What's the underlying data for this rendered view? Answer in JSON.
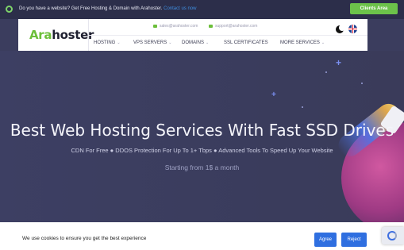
{
  "topbar": {
    "message": "Do you have a website? Get Free Hosting & Domain with Arahoster.",
    "contact_link": "Contact us now",
    "clients_button": "Clients Area"
  },
  "header": {
    "logo_part1": "Ara",
    "logo_part2": "hoster",
    "sales_email": "sales@arahoster.com",
    "support_email": "support@arahoster.com",
    "nav": [
      {
        "label": "HOSTING",
        "dropdown": true
      },
      {
        "label": "VPS SERVERS",
        "dropdown": true
      },
      {
        "label": "DOMAINS",
        "dropdown": true
      },
      {
        "label": "SSL CERTIFICATES",
        "dropdown": false
      },
      {
        "label": "MORE SERVICES",
        "dropdown": true
      }
    ],
    "icons": [
      "dark-mode-icon",
      "uk-flag-icon"
    ]
  },
  "hero": {
    "title": "Best Web Hosting Services With Fast SSD Drives",
    "subtitle": "CDN For Free ● DDOS Protection For Up To 1+ Tbps ● Advanced Tools To Speed Up Your Website",
    "price": "Starting from 1$ a month"
  },
  "cookie": {
    "text": "We use cookies to ensure you get the best experience",
    "agree": "Agree",
    "reject": "Reject"
  },
  "colors": {
    "brand_green": "#6cbf3a",
    "hero_bg": "#3d3f63",
    "button_blue": "#2f6fe0"
  }
}
